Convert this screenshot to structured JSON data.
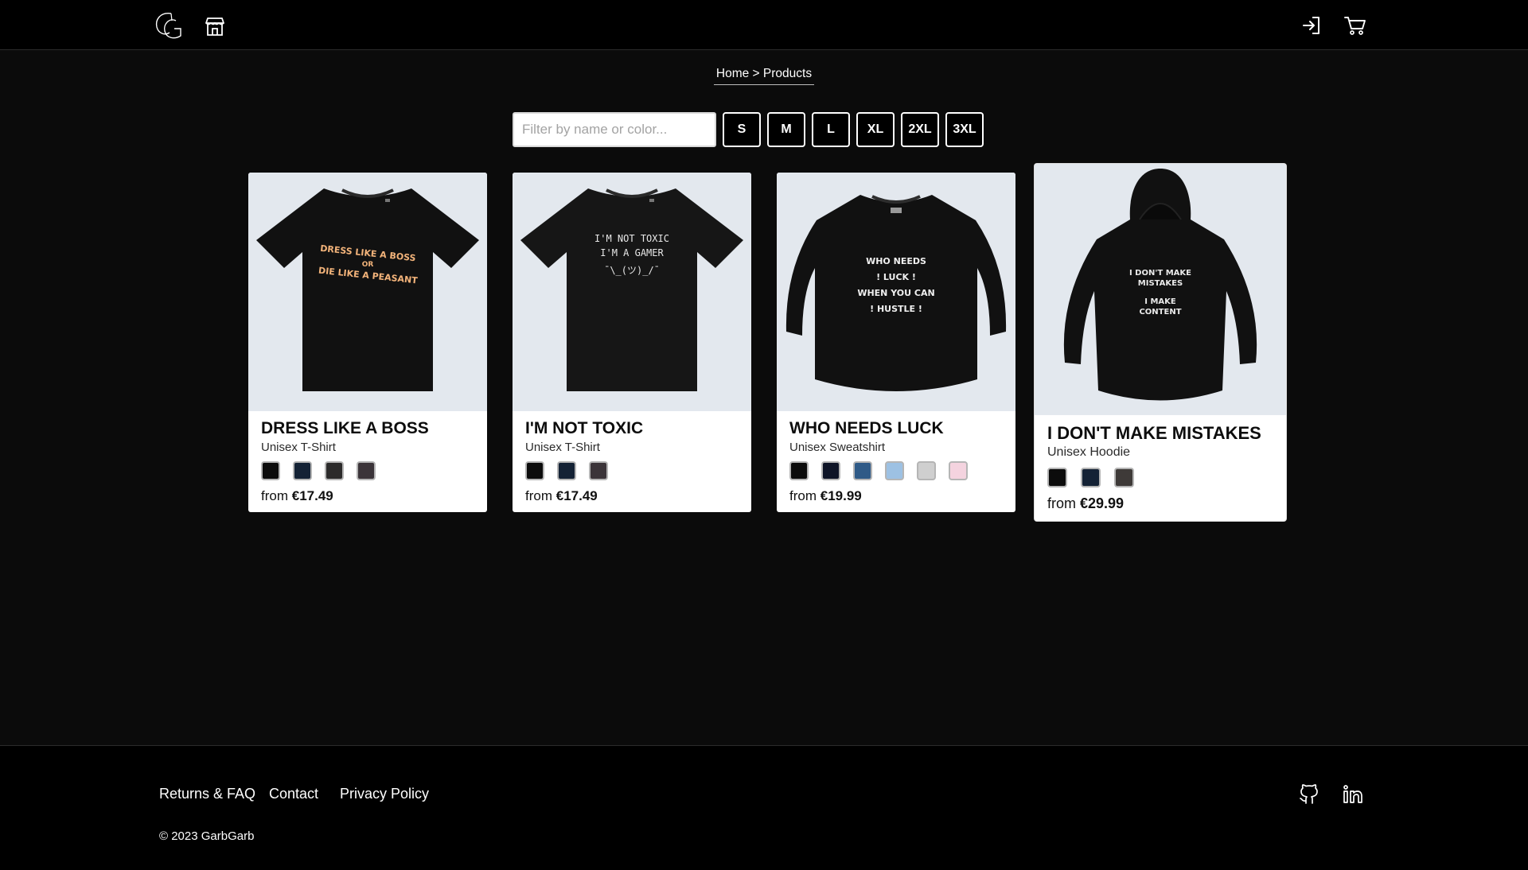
{
  "header": {
    "logo_alt": "GG",
    "icons": [
      "logo-icon",
      "store-icon",
      "login-icon",
      "cart-icon"
    ]
  },
  "breadcrumb": {
    "text": "Home > Products"
  },
  "filter": {
    "placeholder": "Filter by name or color...",
    "sizes": [
      "S",
      "M",
      "L",
      "XL",
      "2XL",
      "3XL"
    ]
  },
  "products": [
    {
      "title": "DRESS LIKE A BOSS",
      "subtitle": "Unisex T-Shirt",
      "price_prefix": "from",
      "price": "€17.49",
      "colors": [
        "#0c0c0c",
        "#142235",
        "#2c2b2b",
        "#3b3439"
      ],
      "print_lines": [
        "DRESS LIKE A BOSS",
        "OR",
        "DIE LIKE A PEASANT"
      ]
    },
    {
      "title": "I'M NOT TOXIC",
      "subtitle": "Unisex T-Shirt",
      "price_prefix": "from",
      "price": "€17.49",
      "colors": [
        "#0c0c0c",
        "#142235",
        "#3b3439"
      ],
      "print_lines": [
        "I'M NOT TOXIC",
        "I'M A GAMER",
        "¯\\_(ツ)_/¯"
      ]
    },
    {
      "title": "WHO NEEDS LUCK",
      "subtitle": "Unisex Sweatshirt",
      "price_prefix": "from",
      "price": "€19.99",
      "colors": [
        "#0c0c0c",
        "#0e1427",
        "#2f5a87",
        "#9dc1e3",
        "#cfcfcf",
        "#f4d3df"
      ],
      "print_lines": [
        "WHO NEEDS",
        "! LUCK !",
        "WHEN YOU CAN",
        "! HUSTLE !"
      ]
    },
    {
      "title": "I DON'T MAKE MISTAKES",
      "subtitle": "Unisex Hoodie",
      "price_prefix": "from",
      "price": "€29.99",
      "colors": [
        "#0c0c0c",
        "#142235",
        "#3e3a38"
      ],
      "print_lines": [
        "I DON'T MAKE",
        "MISTAKES",
        "I MAKE",
        "CONTENT"
      ]
    }
  ],
  "footer": {
    "links": [
      "Returns & FAQ",
      "Contact",
      "Privacy Policy"
    ],
    "copyright": "© 2023 GarbGarb"
  }
}
